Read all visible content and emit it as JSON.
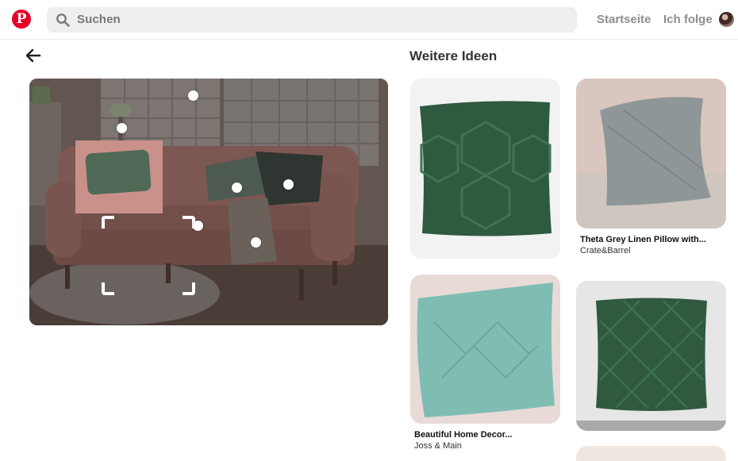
{
  "header": {
    "logo": "P",
    "search_placeholder": "Suchen",
    "nav": {
      "home": "Startseite",
      "following": "Ich folge"
    }
  },
  "section_title": "Weitere Ideen",
  "pins": [
    {
      "title": "",
      "source": ""
    },
    {
      "title": "Theta Grey Linen Pillow with...",
      "source": "Crate&Barrel"
    },
    {
      "title": "Beautiful Home Decor...",
      "source": "Joss & Main"
    },
    {
      "title": "",
      "source": ""
    }
  ],
  "colors": {
    "brand": "#e60023",
    "pillow_green": "#2f5a3f",
    "sofa_pink": "#b07b70"
  }
}
